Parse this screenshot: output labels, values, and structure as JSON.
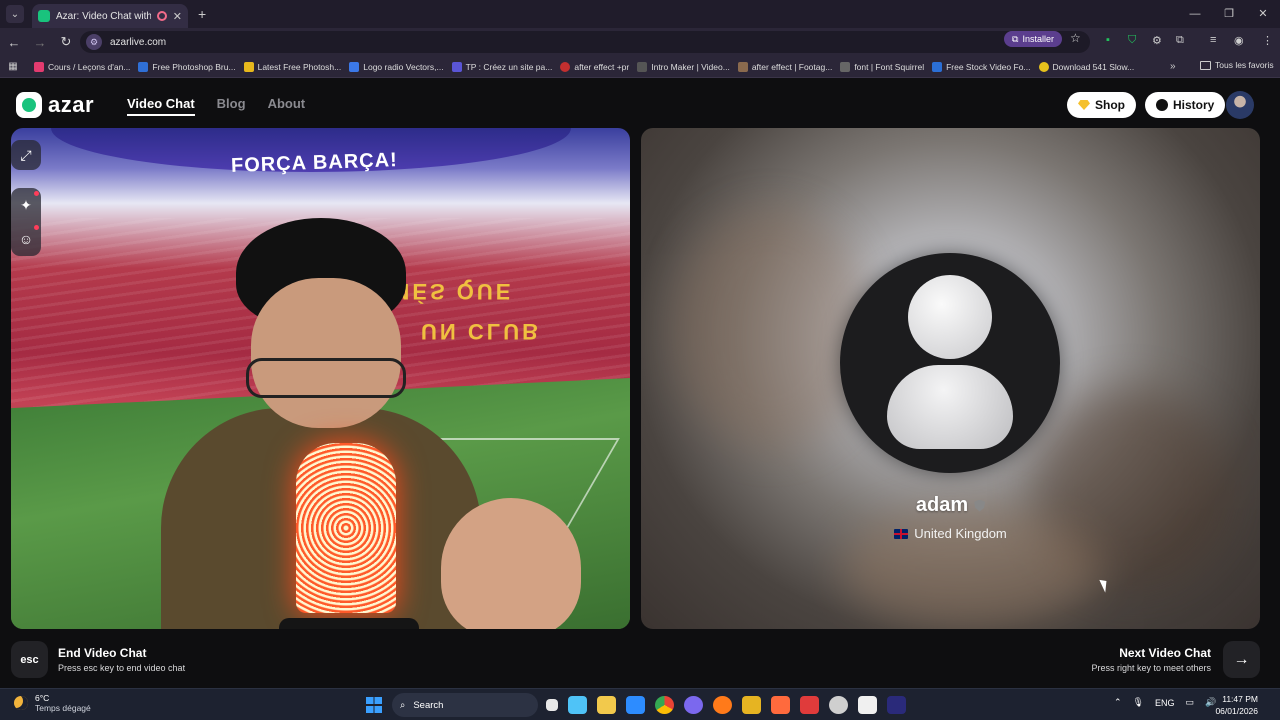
{
  "browser": {
    "tab_title": "Azar: Video Chat with New",
    "url": "azarlive.com",
    "install_label": "Installer",
    "bookmarks": [
      {
        "label": "Cours / Leçons d'an...",
        "color": "#e33b6f"
      },
      {
        "label": "Free Photoshop Bru...",
        "color": "#2f6fd6"
      },
      {
        "label": "Latest Free Photosh...",
        "color": "#e7b81c"
      },
      {
        "label": "Logo radio Vectors,...",
        "color": "#3b78e7"
      },
      {
        "label": "TP : Créez un site pa...",
        "color": "#5a55d6"
      },
      {
        "label": "after effect +pr",
        "color": "#c22f2f"
      },
      {
        "label": "Intro Maker | Video...",
        "color": "#555555"
      },
      {
        "label": "after effect | Footag...",
        "color": "#8a6a4e"
      },
      {
        "label": "font | Font Squirrel",
        "color": "#666666"
      },
      {
        "label": "Free Stock Video Fo...",
        "color": "#2b6fd6"
      },
      {
        "label": "Download 541 Slow...",
        "color": "#e6c21c"
      }
    ],
    "all_bookmarks_label": "Tous les favoris"
  },
  "site": {
    "brand": "azar",
    "nav": {
      "video_chat": "Video Chat",
      "blog": "Blog",
      "about": "About"
    },
    "shop_label": "Shop",
    "history_label": "History"
  },
  "left_video": {
    "banner_text": "FORÇA BARÇA!",
    "seat_text_1": "MÉS QUE",
    "seat_text_2": "UN CLUB",
    "tools": [
      "expand-icon",
      "sparkle-effects-icon",
      "sticker-face-icon"
    ]
  },
  "peer": {
    "name": "adam",
    "country": "United Kingdom"
  },
  "controls": {
    "end": {
      "key": "esc",
      "title": "End Video Chat",
      "subtitle": "Press esc key to end video chat"
    },
    "next": {
      "title": "Next Video Chat",
      "subtitle": "Press right key to meet others"
    }
  },
  "taskbar": {
    "weather_temp": "6°C",
    "weather_desc": "Temps dégagé",
    "search_label": "Search",
    "lang": "ENG",
    "time": "11:47 PM",
    "date": "06/01/2026",
    "app_colors": [
      "#5fa8ff",
      "#4fc3f7",
      "#f2c94c",
      "#2d8cff",
      "#e5e5e5",
      "#7b68ee",
      "#ff7a1a",
      "#e6b422",
      "#ff6a3d",
      "#e03b3b",
      "#cfcfcf",
      "#f0f0f0",
      "#2a2a7a"
    ]
  }
}
